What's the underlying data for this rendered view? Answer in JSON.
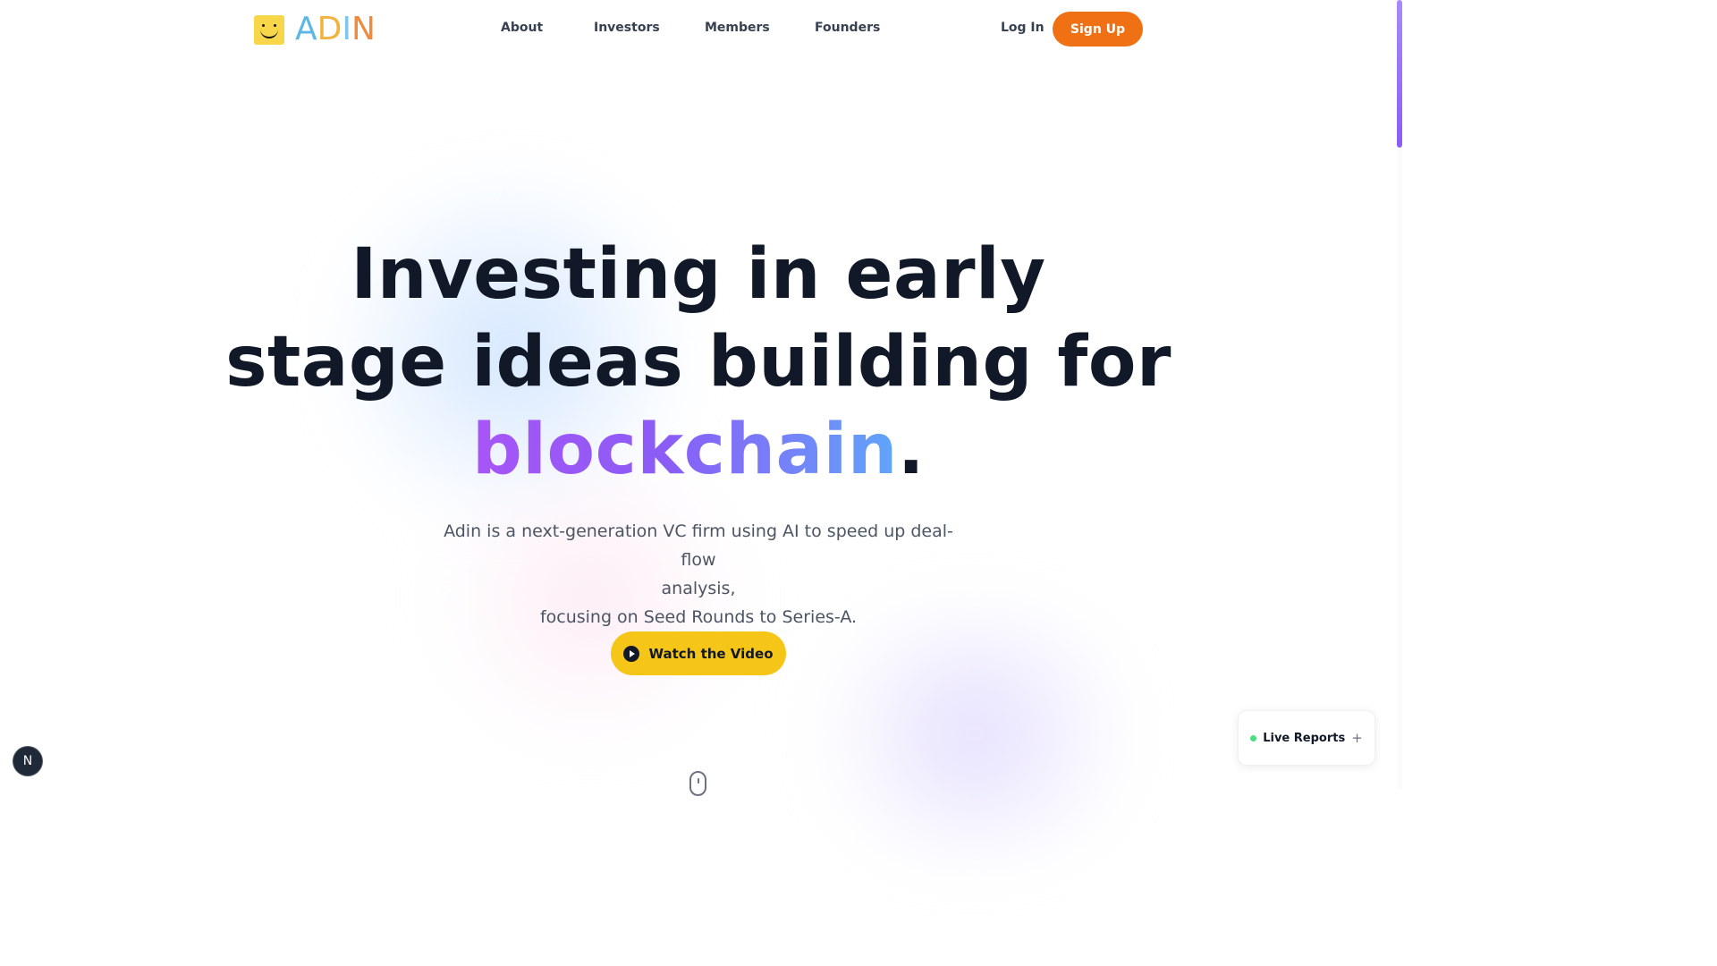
{
  "brand": {
    "name": "ADIN",
    "letters": [
      "A",
      "D",
      "I",
      "N"
    ],
    "letter_colors": [
      "#5bb8e6",
      "#f2b33d",
      "#7fc7e9",
      "#f08a3c"
    ],
    "face_color": "#f7d64a"
  },
  "nav": {
    "links": [
      "About",
      "Investors",
      "Members",
      "Founders"
    ]
  },
  "auth": {
    "login_label": "Log In",
    "signup_label": "Sign Up",
    "signup_color": "#f07113"
  },
  "hero": {
    "line1": "Investing in early",
    "line2": "stage ideas building for",
    "highlight": "blockchain",
    "period": ".",
    "sub_line1": "Adin is a next-generation VC firm using AI to speed up deal-flow",
    "sub_line2": "analysis,",
    "sub_line3": "focusing on Seed Rounds to Series-A.",
    "video_label": "Watch the Video",
    "video_color": "#f5c518"
  },
  "live_reports": {
    "label": "Live Reports",
    "plus": "+"
  },
  "dev_badge": {
    "letter": "N"
  }
}
